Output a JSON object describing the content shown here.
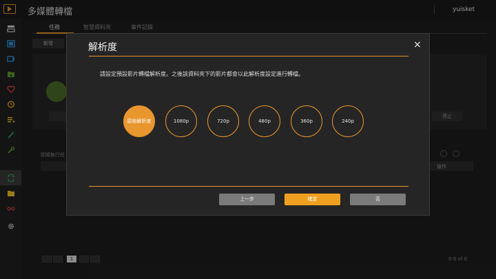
{
  "header": {
    "app_title": "多媒體轉檔",
    "username": "yuisket"
  },
  "sidebar": {
    "items": [
      {
        "icon": "library-icon",
        "color": "#d0d0d0"
      },
      {
        "icon": "video-icon",
        "color": "#2f8fd8"
      },
      {
        "icon": "camera-icon",
        "color": "#2f8fd8"
      },
      {
        "icon": "folder-music-icon",
        "color": "#5a9a2a"
      },
      {
        "icon": "heart-icon",
        "color": "#d04040"
      },
      {
        "icon": "clock-icon",
        "color": "#e8a020"
      },
      {
        "icon": "list-icon",
        "color": "#e8c020"
      },
      {
        "icon": "wand-icon",
        "color": "#3aa060"
      },
      {
        "icon": "wrench-icon",
        "color": "#5a9a2a"
      },
      {
        "icon": "convert-icon",
        "color": "#3aa060"
      },
      {
        "icon": "folder-icon",
        "color": "#e8c020"
      },
      {
        "icon": "recycle-icon",
        "color": "#d04040"
      },
      {
        "icon": "gear-icon",
        "color": "#d0d0d0"
      }
    ]
  },
  "main": {
    "tabs": [
      {
        "label": "任務"
      },
      {
        "label": "智慧資料夾"
      },
      {
        "label": "事件記錄"
      }
    ],
    "new_button": "新增",
    "stop_button": "停止",
    "queue_label": "即將執行任",
    "queue_op": "操作",
    "pager_page": "1",
    "pager_count": "0-0 of 0"
  },
  "modal": {
    "title": "解析度",
    "close": "×",
    "description": "請設定預設影片轉檔解析度。之後該資料夾下的影片都會以此解析度設定進行轉檔。",
    "options": [
      {
        "label": "原始解析度",
        "selected": true
      },
      {
        "label": "1080p",
        "selected": false
      },
      {
        "label": "720p",
        "selected": false
      },
      {
        "label": "480p",
        "selected": false
      },
      {
        "label": "360p",
        "selected": false
      },
      {
        "label": "240p",
        "selected": false
      }
    ],
    "buttons": {
      "prev": "上一步",
      "confirm": "確定",
      "no": "否"
    }
  },
  "colors": {
    "accent": "#e8962e",
    "confirm": "#f0a020"
  }
}
